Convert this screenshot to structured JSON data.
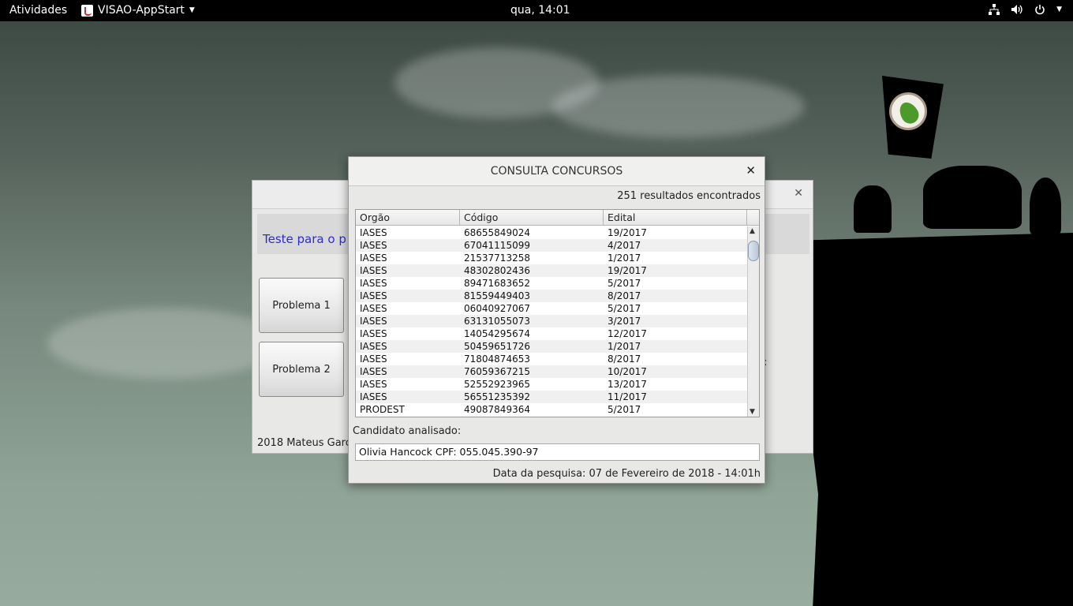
{
  "topbar": {
    "activities": "Atividades",
    "app_name": "VISAO-AppStart",
    "clock": "qua, 14:01",
    "icons": [
      "network-icon",
      "volume-icon",
      "power-icon"
    ]
  },
  "background_window": {
    "header_text": "Teste para o p",
    "buttons": [
      "Problema 1",
      "Problema 2"
    ],
    "side_text": "o:",
    "footer": "2018 Mateus Garc"
  },
  "dialog": {
    "title": "CONSULTA CONCURSOS",
    "result_count": "251 resultados encontrados",
    "columns": [
      "Orgão",
      "Código",
      "Edital"
    ],
    "rows": [
      [
        "IASES",
        "68655849024",
        "19/2017"
      ],
      [
        "IASES",
        "67041115099",
        "4/2017"
      ],
      [
        "IASES",
        "21537713258",
        "1/2017"
      ],
      [
        "IASES",
        "48302802436",
        "19/2017"
      ],
      [
        "IASES",
        "89471683652",
        "5/2017"
      ],
      [
        "IASES",
        "81559449403",
        "8/2017"
      ],
      [
        "IASES",
        "06040927067",
        "5/2017"
      ],
      [
        "IASES",
        "63131055073",
        "3/2017"
      ],
      [
        "IASES",
        "14054295674",
        "12/2017"
      ],
      [
        "IASES",
        "50459651726",
        "1/2017"
      ],
      [
        "IASES",
        "71804874653",
        "8/2017"
      ],
      [
        "IASES",
        "76059367215",
        "10/2017"
      ],
      [
        "IASES",
        "52552923965",
        "13/2017"
      ],
      [
        "IASES",
        "56551235392",
        "11/2017"
      ],
      [
        "PRODEST",
        "49087849364",
        "5/2017"
      ]
    ],
    "candidate_label": "Candidato analisado:",
    "candidate_value": "Olivia Hancock CPF: 055.045.390-97",
    "search_date": "Data da pesquisa: 07 de Fevereiro de 2018 - 14:01h"
  }
}
